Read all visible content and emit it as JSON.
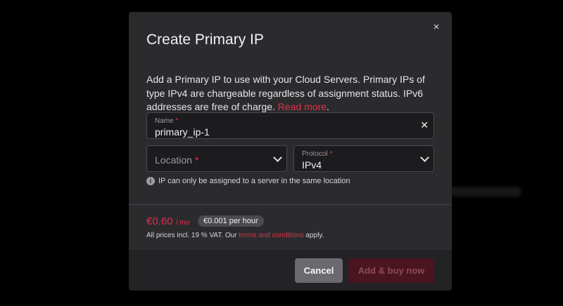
{
  "dialog": {
    "title": "Create Primary IP",
    "close_glyph": "×",
    "description": "Add a Primary IP to use with your Cloud Servers. Primary IPs of type IPv4 are chargeable regardless of assignment status. IPv6 addresses are free of charge.",
    "read_more": "Read more",
    "period": "."
  },
  "form": {
    "name": {
      "label": "Name",
      "required": "*",
      "value": "primary_ip-1",
      "clear_glyph": "✕"
    },
    "location": {
      "placeholder": "Location",
      "required": "*"
    },
    "protocol": {
      "label": "Protocol",
      "required": "*",
      "value": "IPv4"
    },
    "hint": "IP can only be assigned to a server in the same location",
    "hint_icon_glyph": "i"
  },
  "pricing": {
    "monthly": "€0.60",
    "monthly_unit": "/ mo",
    "hourly": "€0.001 per hour",
    "vat_prefix": "All prices incl. 19 % VAT. Our ",
    "terms_link": "terms and conditions",
    "vat_suffix": " apply."
  },
  "footer": {
    "cancel_label": "Cancel",
    "buy_label": "Add & buy now"
  },
  "colors": {
    "accent": "#e0304a",
    "modal_bg": "#2b2b2e",
    "field_bg": "#1c1c1e"
  },
  "icons": [
    "close-icon",
    "clear-icon",
    "chevron-down-icon",
    "info-icon"
  ]
}
